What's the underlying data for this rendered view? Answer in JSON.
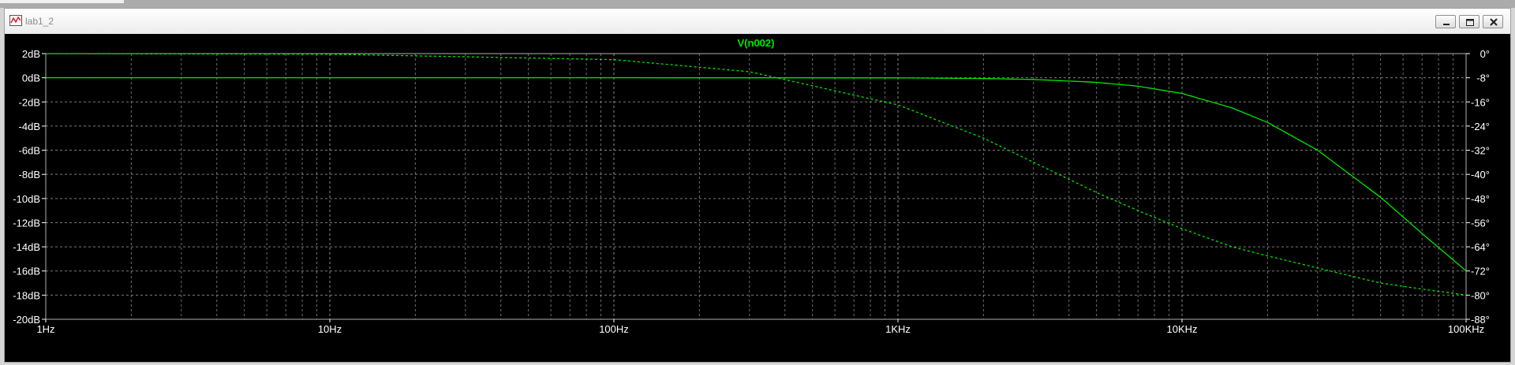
{
  "window": {
    "title": "lab1_2",
    "icons": [
      "waveform-icon",
      "minimize-icon",
      "restore-icon",
      "close-icon"
    ]
  },
  "colors": {
    "trace": "#00e600",
    "grid": "#9a9a9a",
    "axis_text": "#ffffff",
    "background": "#000000"
  },
  "chart_data": {
    "type": "line",
    "title": "V(n002)",
    "x_scale": "log",
    "xlim": [
      1,
      100000
    ],
    "x_ticks": [
      "1Hz",
      "10Hz",
      "100Hz",
      "1KHz",
      "10KHz",
      "100KHz"
    ],
    "ylim_left": [
      -20,
      2
    ],
    "y_ticks_left": [
      "2dB",
      "0dB",
      "-2dB",
      "-4dB",
      "-6dB",
      "-8dB",
      "-10dB",
      "-12dB",
      "-14dB",
      "-16dB",
      "-18dB",
      "-20dB"
    ],
    "ylim_right": [
      -88,
      0
    ],
    "y_ticks_right": [
      "0°",
      "-8°",
      "-16°",
      "-24°",
      "-32°",
      "-40°",
      "-48°",
      "-56°",
      "-64°",
      "-72°",
      "-80°",
      "-88°"
    ],
    "grid": true,
    "series": [
      {
        "axis": "left",
        "style": "solid",
        "x": [
          1,
          10,
          100,
          1000,
          2000,
          3000,
          5000,
          7000,
          10000,
          15000,
          20000,
          30000,
          50000,
          70000,
          100000
        ],
        "values": [
          0,
          0,
          0,
          -0.01,
          -0.06,
          -0.14,
          -0.38,
          -0.7,
          -1.3,
          -2.5,
          -3.7,
          -6.0,
          -9.9,
          -12.9,
          -16.0
        ]
      },
      {
        "axis": "right",
        "style": "dashed",
        "x": [
          1,
          10,
          100,
          300,
          1000,
          2000,
          3000,
          5000,
          7000,
          10000,
          15000,
          20000,
          30000,
          50000,
          70000,
          100000
        ],
        "values": [
          -0.02,
          -0.2,
          -2,
          -6,
          -17,
          -28,
          -36,
          -46,
          -52,
          -58,
          -64,
          -67,
          -71,
          -76,
          -78,
          -80
        ]
      }
    ]
  }
}
